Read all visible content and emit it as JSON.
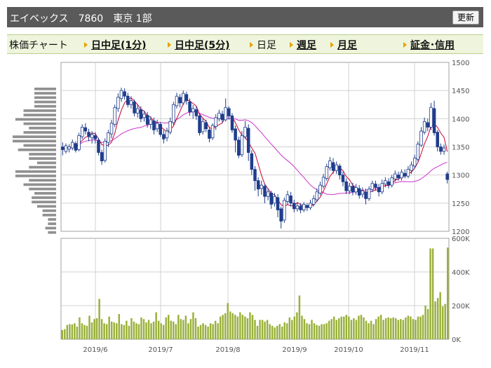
{
  "header": {
    "title": "エイベックス　7860　東京 1部",
    "refresh_label": "更新"
  },
  "nav": {
    "label": "株価チャート",
    "items": [
      {
        "label": "日中足(1分)",
        "link": true
      },
      {
        "label": "日中足(5分)",
        "link": true
      },
      {
        "label": "日足",
        "link": false
      },
      {
        "label": "週足",
        "link": true
      },
      {
        "label": "月足",
        "link": true
      },
      {
        "label": "証金･信用",
        "link": true
      }
    ]
  },
  "colors": {
    "candle": "#1f3d8c",
    "ma_short": "#cc0033",
    "ma_long": "#cc33cc",
    "volume": "#99b03a",
    "profile": "#909090",
    "grid": "#d0d0d0",
    "frame": "#a0a0a0"
  },
  "chart_data": [
    {
      "type": "candlestick",
      "title": "",
      "ylim": [
        1200,
        1500
      ],
      "y_ticks": [
        "1500",
        "1450",
        "1400",
        "1350",
        "1300",
        "1250",
        "1200"
      ],
      "x_ticks": [
        "2019/6",
        "2019/7",
        "2019/8",
        "2019/9",
        "2019/10",
        "2019/11"
      ],
      "grid": true,
      "candles": [
        [
          1350,
          1345,
          1358,
          1335
        ],
        [
          1342,
          1352,
          1356,
          1338
        ],
        [
          1346,
          1350,
          1355,
          1340
        ],
        [
          1348,
          1358,
          1363,
          1344
        ],
        [
          1356,
          1344,
          1360,
          1340
        ],
        [
          1345,
          1370,
          1375,
          1342
        ],
        [
          1368,
          1385,
          1390,
          1364
        ],
        [
          1384,
          1378,
          1392,
          1372
        ],
        [
          1376,
          1368,
          1382,
          1360
        ],
        [
          1366,
          1372,
          1378,
          1356
        ],
        [
          1370,
          1364,
          1376,
          1356
        ],
        [
          1362,
          1340,
          1366,
          1335
        ],
        [
          1340,
          1325,
          1345,
          1318
        ],
        [
          1326,
          1360,
          1365,
          1322
        ],
        [
          1358,
          1375,
          1380,
          1350
        ],
        [
          1373,
          1392,
          1398,
          1365
        ],
        [
          1390,
          1420,
          1425,
          1385
        ],
        [
          1418,
          1438,
          1445,
          1412
        ],
        [
          1436,
          1450,
          1455,
          1430
        ],
        [
          1448,
          1440,
          1454,
          1434
        ],
        [
          1440,
          1425,
          1446,
          1420
        ],
        [
          1425,
          1432,
          1440,
          1418
        ],
        [
          1430,
          1410,
          1434,
          1404
        ],
        [
          1410,
          1418,
          1426,
          1402
        ],
        [
          1416,
          1400,
          1422,
          1394
        ],
        [
          1402,
          1408,
          1414,
          1395
        ],
        [
          1406,
          1390,
          1412,
          1384
        ],
        [
          1390,
          1398,
          1404,
          1382
        ],
        [
          1396,
          1380,
          1402,
          1372
        ],
        [
          1382,
          1392,
          1398,
          1376
        ],
        [
          1390,
          1372,
          1394,
          1368
        ],
        [
          1372,
          1364,
          1380,
          1356
        ],
        [
          1366,
          1378,
          1384,
          1360
        ],
        [
          1376,
          1395,
          1402,
          1372
        ],
        [
          1393,
          1425,
          1430,
          1388
        ],
        [
          1423,
          1440,
          1446,
          1418
        ],
        [
          1438,
          1428,
          1444,
          1420
        ],
        [
          1428,
          1445,
          1450,
          1424
        ],
        [
          1443,
          1432,
          1448,
          1425
        ],
        [
          1430,
          1412,
          1436,
          1405
        ],
        [
          1412,
          1418,
          1424,
          1400
        ],
        [
          1416,
          1405,
          1422,
          1398
        ],
        [
          1405,
          1375,
          1410,
          1370
        ],
        [
          1377,
          1395,
          1400,
          1372
        ],
        [
          1393,
          1382,
          1398,
          1376
        ],
        [
          1380,
          1365,
          1386,
          1358
        ],
        [
          1366,
          1388,
          1392,
          1362
        ],
        [
          1386,
          1402,
          1408,
          1380
        ],
        [
          1400,
          1410,
          1416,
          1395
        ],
        [
          1408,
          1398,
          1414,
          1392
        ],
        [
          1398,
          1420,
          1436,
          1395
        ],
        [
          1418,
          1405,
          1422,
          1398
        ],
        [
          1405,
          1380,
          1410,
          1375
        ],
        [
          1382,
          1362,
          1388,
          1340
        ],
        [
          1362,
          1335,
          1368,
          1330
        ],
        [
          1336,
          1370,
          1378,
          1332
        ],
        [
          1368,
          1385,
          1396,
          1364
        ],
        [
          1383,
          1340,
          1390,
          1325
        ],
        [
          1338,
          1310,
          1344,
          1300
        ],
        [
          1310,
          1290,
          1316,
          1272
        ],
        [
          1290,
          1275,
          1296,
          1262
        ],
        [
          1276,
          1282,
          1290,
          1265
        ],
        [
          1280,
          1262,
          1284,
          1250
        ],
        [
          1262,
          1270,
          1276,
          1255
        ],
        [
          1268,
          1248,
          1272,
          1240
        ],
        [
          1250,
          1262,
          1268,
          1244
        ],
        [
          1260,
          1238,
          1266,
          1225
        ],
        [
          1240,
          1218,
          1244,
          1205
        ],
        [
          1220,
          1255,
          1260,
          1215
        ],
        [
          1253,
          1265,
          1272,
          1248
        ],
        [
          1263,
          1250,
          1270,
          1244
        ],
        [
          1250,
          1240,
          1256,
          1234
        ],
        [
          1240,
          1245,
          1252,
          1235
        ],
        [
          1245,
          1238,
          1250,
          1232
        ],
        [
          1238,
          1248,
          1252,
          1234
        ],
        [
          1246,
          1242,
          1250,
          1236
        ],
        [
          1242,
          1250,
          1256,
          1238
        ],
        [
          1248,
          1258,
          1264,
          1244
        ],
        [
          1256,
          1270,
          1276,
          1252
        ],
        [
          1268,
          1282,
          1288,
          1264
        ],
        [
          1280,
          1296,
          1302,
          1276
        ],
        [
          1294,
          1315,
          1320,
          1290
        ],
        [
          1313,
          1325,
          1332,
          1308
        ],
        [
          1322,
          1308,
          1330,
          1302
        ],
        [
          1308,
          1318,
          1324,
          1302
        ],
        [
          1316,
          1300,
          1320,
          1292
        ],
        [
          1300,
          1288,
          1306,
          1280
        ],
        [
          1288,
          1272,
          1294,
          1266
        ],
        [
          1272,
          1280,
          1286,
          1266
        ],
        [
          1280,
          1270,
          1286,
          1264
        ],
        [
          1270,
          1278,
          1284,
          1265
        ],
        [
          1276,
          1264,
          1282,
          1258
        ],
        [
          1266,
          1272,
          1278,
          1260
        ],
        [
          1270,
          1258,
          1276,
          1248
        ],
        [
          1258,
          1275,
          1280,
          1254
        ],
        [
          1274,
          1285,
          1290,
          1270
        ],
        [
          1284,
          1278,
          1290,
          1272
        ],
        [
          1278,
          1270,
          1284,
          1262
        ],
        [
          1270,
          1285,
          1292,
          1266
        ],
        [
          1284,
          1290,
          1296,
          1278
        ],
        [
          1288,
          1282,
          1294,
          1276
        ],
        [
          1282,
          1295,
          1300,
          1278
        ],
        [
          1293,
          1302,
          1308,
          1288
        ],
        [
          1300,
          1295,
          1306,
          1290
        ],
        [
          1295,
          1305,
          1310,
          1290
        ],
        [
          1303,
          1298,
          1310,
          1294
        ],
        [
          1298,
          1310,
          1316,
          1294
        ],
        [
          1308,
          1318,
          1324,
          1302
        ],
        [
          1316,
          1330,
          1336,
          1312
        ],
        [
          1328,
          1355,
          1360,
          1324
        ],
        [
          1353,
          1378,
          1385,
          1350
        ],
        [
          1376,
          1395,
          1402,
          1372
        ],
        [
          1393,
          1385,
          1400,
          1378
        ],
        [
          1385,
          1420,
          1428,
          1380
        ],
        [
          1418,
          1375,
          1432,
          1370
        ],
        [
          1376,
          1350,
          1380,
          1342
        ],
        [
          1350,
          1342,
          1356,
          1336
        ],
        [
          1342,
          1348,
          1354,
          1336
        ],
        [
          1302,
          1292,
          1306,
          1285
        ]
      ],
      "volume": {
        "ylim": [
          0,
          600
        ],
        "unit": "K",
        "y_ticks": [
          "600K",
          "400K",
          "200K",
          "0K"
        ],
        "values": [
          55,
          60,
          85,
          90,
          88,
          95,
          75,
          130,
          95,
          85,
          80,
          140,
          100,
          120,
          125,
          240,
          120,
          95,
          90,
          135,
          105,
          100,
          95,
          150,
          90,
          85,
          110,
          80,
          125,
          105,
          95,
          90,
          130,
          120,
          100,
          115,
          95,
          105,
          160,
          110,
          95,
          85,
          130,
          145,
          110,
          105,
          90,
          145,
          120,
          115,
          140,
          95,
          120,
          160,
          125,
          75,
          85,
          95,
          85,
          75,
          95,
          90,
          110,
          95,
          135,
          145,
          155,
          215,
          165,
          155,
          145,
          135,
          160,
          145,
          135,
          125,
          160,
          145,
          115,
          80,
          115,
          115,
          105,
          115,
          90,
          80,
          70,
          80,
          90,
          75,
          100,
          95,
          130,
          115,
          135,
          160,
          260,
          140,
          120,
          95,
          90,
          115,
          95,
          85,
          80,
          90,
          90,
          95,
          110,
          120,
          135,
          115,
          125,
          135,
          135,
          145,
          135,
          115,
          125,
          115,
          140,
          145,
          130,
          110,
          95,
          110,
          90,
          120,
          135,
          145,
          115,
          125,
          130,
          125,
          130,
          125,
          115,
          120,
          115,
          130,
          140,
          135,
          120,
          115,
          135,
          135,
          145,
          200,
          180,
          540,
          540,
          225,
          245,
          280,
          195,
          210,
          545
        ]
      },
      "volume_profile": [
        40,
        40,
        40,
        40,
        40,
        60,
        60,
        75,
        60,
        50,
        60,
        80,
        80,
        60,
        70,
        50,
        50,
        35,
        50,
        75,
        75,
        50,
        60,
        50,
        40,
        45,
        45,
        35,
        25,
        25,
        15,
        15,
        20,
        15
      ]
    }
  ]
}
